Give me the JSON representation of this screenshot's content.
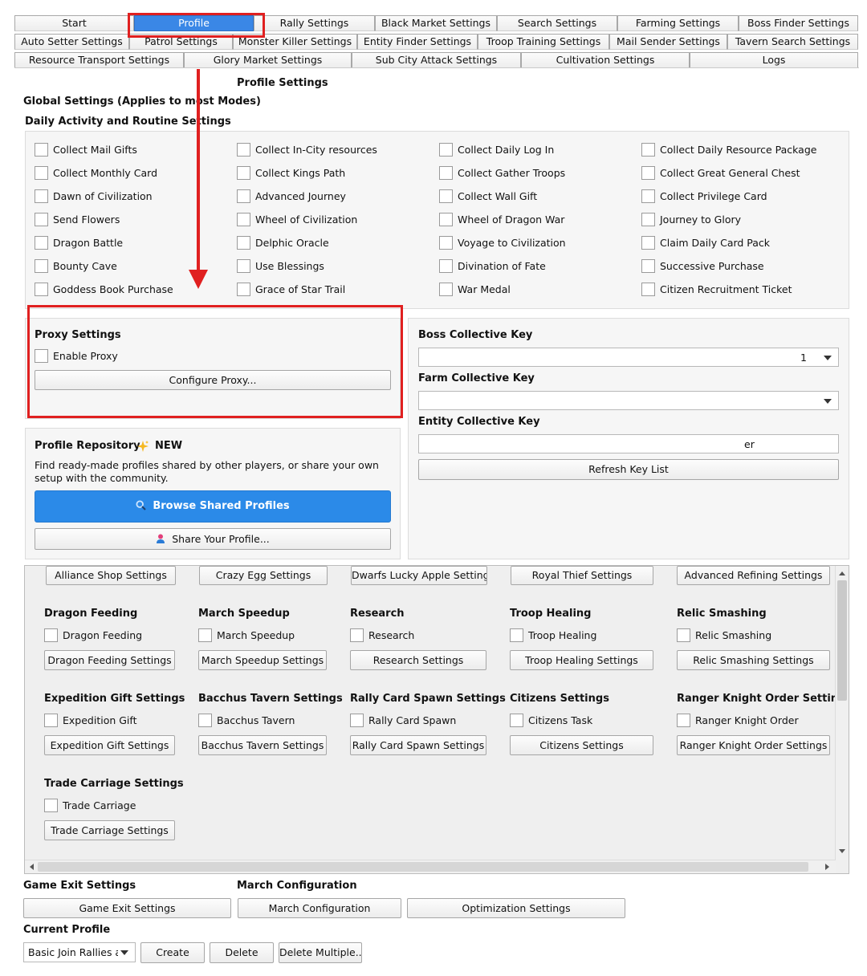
{
  "tabs": {
    "row1": [
      "Start",
      "Profile",
      "Rally Settings",
      "Black Market Settings",
      "Search Settings",
      "Farming Settings",
      "Boss Finder Settings"
    ],
    "row2": [
      "Auto Setter Settings",
      "Patrol Settings",
      "Monster Killer Settings",
      "Entity Finder Settings",
      "Troop Training Settings",
      "Mail Sender Settings",
      "Tavern Search Settings"
    ],
    "row3": [
      "Resource Transport Settings",
      "Glory Market Settings",
      "Sub City Attack Settings",
      "Cultivation Settings",
      "Logs"
    ],
    "selected": "Profile"
  },
  "page_title": "Profile Settings",
  "global_settings_title": "Global Settings (Applies to most Modes)",
  "daily_title": "Daily Activity and Routine Settings",
  "daily_items": [
    "Collect Mail Gifts",
    "Collect In-City resources",
    "Collect Daily Log In",
    "Collect Daily Resource Package",
    "Collect Monthly Card",
    "Collect Kings Path",
    "Collect Gather Troops",
    "Collect Great General Chest",
    "Dawn of Civilization",
    "Advanced Journey",
    "Collect Wall Gift",
    "Collect Privilege Card",
    "Send Flowers",
    "Wheel of Civilization",
    "Wheel of Dragon War",
    "Journey to Glory",
    "Dragon Battle",
    "Delphic Oracle",
    "Voyage to Civilization",
    "Claim Daily Card Pack",
    "Bounty Cave",
    "Use Blessings",
    "Divination of Fate",
    "Successive Purchase",
    "Goddess Book Purchase",
    "Grace of Star Trail",
    "War Medal",
    "Citizen Recruitment Ticket"
  ],
  "proxy": {
    "title": "Proxy Settings",
    "enable_label": "Enable Proxy",
    "configure_button": "Configure Proxy..."
  },
  "repository": {
    "title": "Profile Repository",
    "badge": "NEW",
    "description": "Find ready-made profiles shared by other players, or share your own setup with the community.",
    "browse_button": "Browse Shared Profiles",
    "share_button": "Share Your Profile..."
  },
  "keys": {
    "boss_title": "Boss Collective Key",
    "boss_value_suffix": "1",
    "farm_title": "Farm Collective Key",
    "entity_title": "Entity Collective Key",
    "entity_value_suffix": "er",
    "refresh_button": "Refresh Key List"
  },
  "top_buttons": [
    "Alliance Shop Settings",
    "Crazy Egg Settings",
    "Dwarfs Lucky Apple Settings",
    "Royal Thief Settings",
    "Advanced Refining Settings"
  ],
  "feature_groups": [
    {
      "title": "Dragon Feeding",
      "checkbox": "Dragon Feeding",
      "button": "Dragon Feeding Settings"
    },
    {
      "title": "March Speedup",
      "checkbox": "March Speedup",
      "button": "March Speedup Settings"
    },
    {
      "title": "Research",
      "checkbox": "Research",
      "button": "Research Settings"
    },
    {
      "title": "Troop Healing",
      "checkbox": "Troop Healing",
      "button": "Troop Healing Settings"
    },
    {
      "title": "Relic Smashing",
      "checkbox": "Relic Smashing",
      "button": "Relic Smashing Settings"
    },
    {
      "title": "Expedition Gift Settings",
      "checkbox": "Expedition Gift",
      "button": "Expedition Gift Settings"
    },
    {
      "title": "Bacchus Tavern Settings",
      "checkbox": "Bacchus Tavern",
      "button": "Bacchus Tavern Settings"
    },
    {
      "title": "Rally Card Spawn Settings",
      "checkbox": "Rally Card Spawn",
      "button": "Rally Card Spawn Settings"
    },
    {
      "title": "Citizens Settings",
      "checkbox": "Citizens Task",
      "button": "Citizens Settings"
    },
    {
      "title": "Ranger Knight Order Settings",
      "checkbox": "Ranger Knight Order",
      "button": "Ranger Knight Order Settings"
    },
    {
      "title": "Trade Carriage Settings",
      "checkbox": "Trade Carriage",
      "button": "Trade Carriage Settings"
    }
  ],
  "bottom": {
    "game_exit_title": "Game Exit Settings",
    "march_config_title": "March Configuration",
    "game_exit_button": "Game Exit Settings",
    "march_config_button": "March Configuration",
    "optimization_button": "Optimization Settings",
    "current_profile_title": "Current Profile",
    "profile_value": "Basic Join Rallies ar",
    "create_button": "Create",
    "delete_button": "Delete",
    "delete_multiple_button": "Delete Multiple..."
  },
  "colors": {
    "annotation": "#e02020",
    "primary": "#2b8ae8",
    "selected_tab": "#3a87e6"
  }
}
